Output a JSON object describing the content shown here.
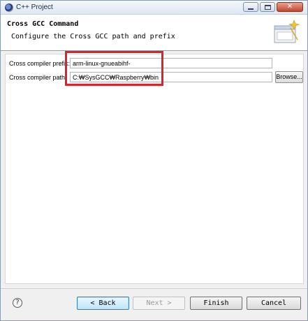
{
  "window": {
    "title": "C++ Project"
  },
  "header": {
    "title": "Cross GCC Command",
    "description": "Configure the Cross GCC path and prefix"
  },
  "form": {
    "prefix": {
      "label": "Cross compiler prefix:",
      "value": "arm-linux-gnueabihf-"
    },
    "path": {
      "label": "Cross compiler path:",
      "value": "C:₩SysGCC₩Raspberry₩bin",
      "browse_label": "Browse..."
    }
  },
  "buttons": {
    "back": "< Back",
    "next": "Next >",
    "finish": "Finish",
    "cancel": "Cancel",
    "help_glyph": "?"
  },
  "colors": {
    "highlight": "#e0202a",
    "accent": "#3c7fb1"
  },
  "icons": [
    "app-icon",
    "minimize-icon",
    "maximize-icon",
    "close-icon",
    "wizard-banner-icon",
    "help-icon"
  ]
}
